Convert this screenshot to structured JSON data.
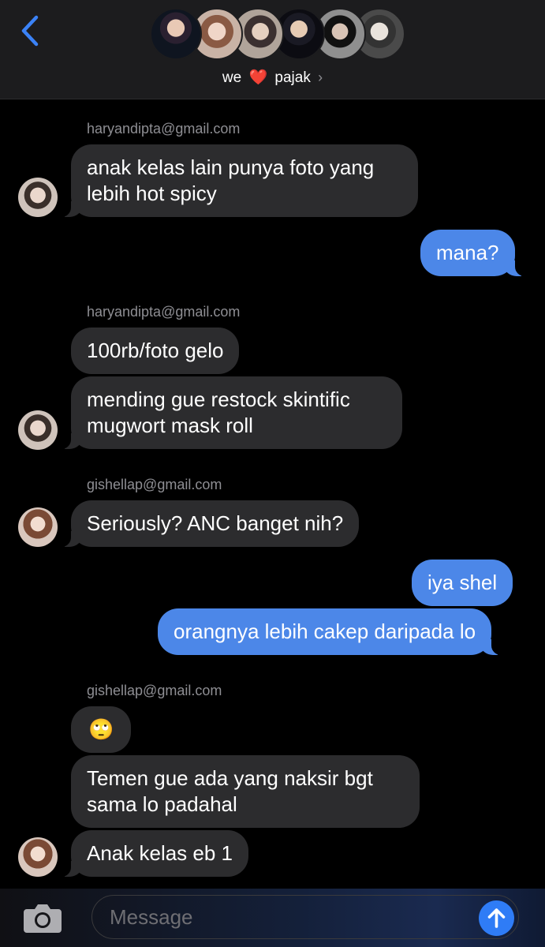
{
  "header": {
    "group_name_left": "we",
    "group_name_heart": "❤️",
    "group_name_right": "pajak",
    "chevron": "›",
    "back_icon": "chevron-left-icon"
  },
  "messages": [
    {
      "sender": "haryandipta@gmail.com"
    },
    {
      "text": "anak kelas lain punya foto yang",
      "text2": "lebih hot spicy"
    },
    {
      "text": "mana?"
    },
    {
      "sender": "haryandipta@gmail.com"
    },
    {
      "text": "100rb/foto gelo"
    },
    {
      "text": "mending gue restock skintific",
      "text2": "mugwort mask roll"
    },
    {
      "sender": "gishellap@gmail.com"
    },
    {
      "text": "Seriously? ANC banget nih?"
    },
    {
      "text": "iya shel"
    },
    {
      "text": "orangnya lebih cakep daripada lo"
    },
    {
      "sender": "gishellap@gmail.com"
    },
    {
      "text": "🙄"
    },
    {
      "text": "Temen gue ada yang naksir bgt",
      "text2": "sama lo padahal"
    },
    {
      "text": "Anak kelas eb 1"
    }
  ],
  "composer": {
    "placeholder": "Message",
    "camera_icon": "camera-icon",
    "send_icon": "arrow-up-icon"
  },
  "colors": {
    "incoming_bubble": "#2c2c2e",
    "outgoing_bubble": "#4c87e8",
    "accent": "#2f7cf6",
    "background": "#000000"
  }
}
